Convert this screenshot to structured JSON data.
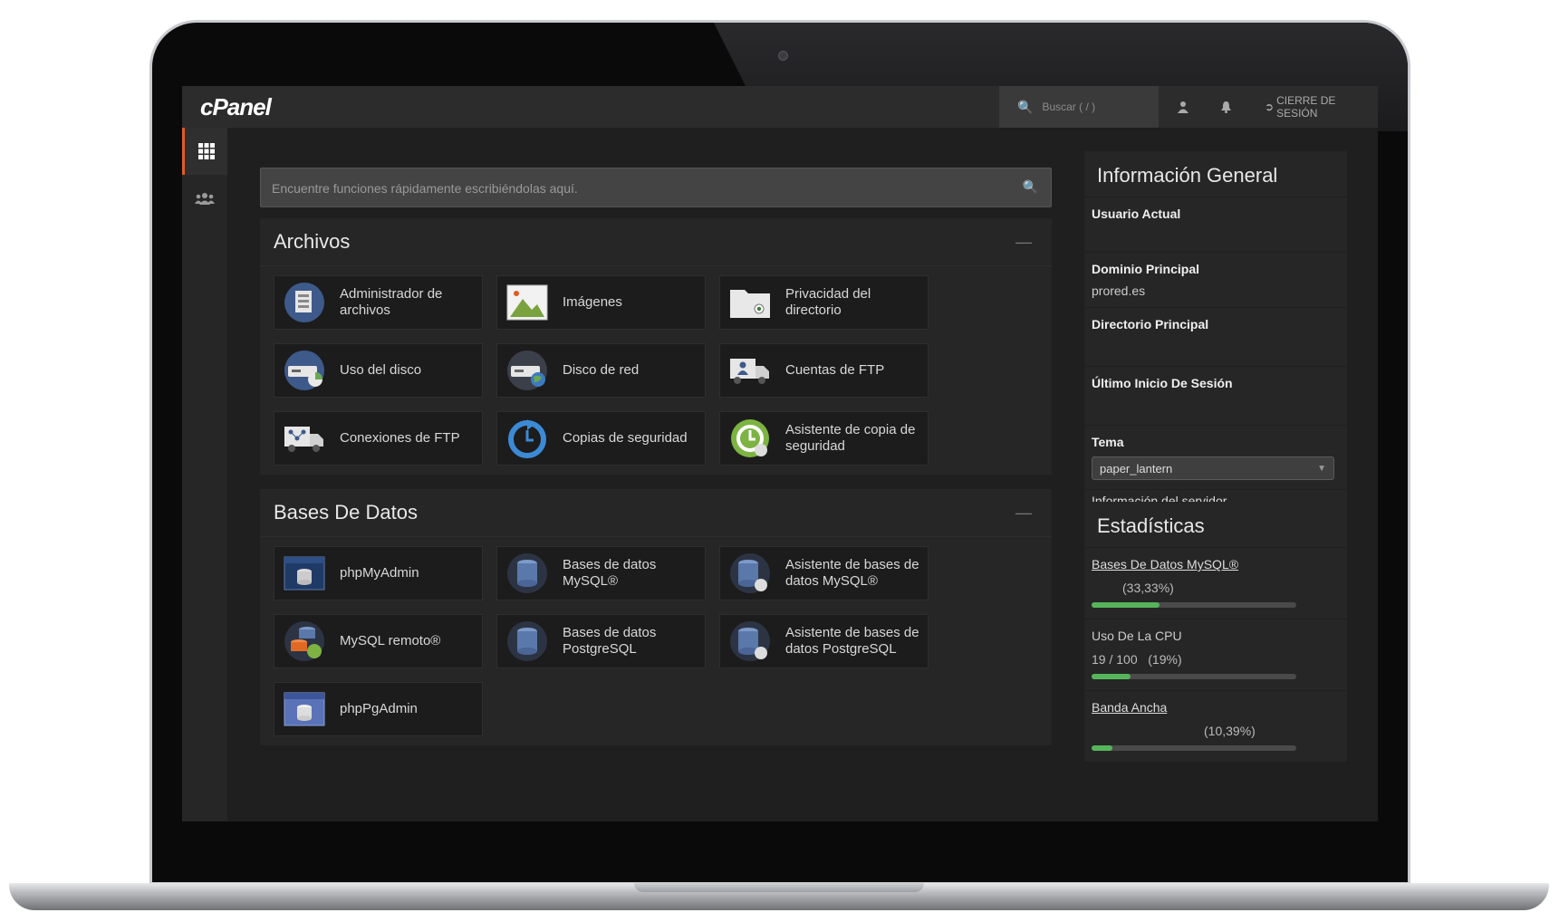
{
  "header": {
    "logo": "cPanel",
    "search_placeholder": "Buscar ( / )",
    "logout_label": "CIERRE DE SESIÓN"
  },
  "sidebar": {
    "items": [
      {
        "icon": "grid-icon"
      },
      {
        "icon": "users-icon"
      }
    ]
  },
  "find": {
    "placeholder": "Encuentre funciones rápidamente escribiéndolas aquí."
  },
  "sections": {
    "files": {
      "title": "Archivos",
      "items": [
        {
          "label": "Administrador de archivos"
        },
        {
          "label": "Imágenes"
        },
        {
          "label": "Privacidad del directorio"
        },
        {
          "label": "Uso del disco"
        },
        {
          "label": "Disco de red"
        },
        {
          "label": "Cuentas de FTP"
        },
        {
          "label": "Conexiones de FTP"
        },
        {
          "label": "Copias de seguridad"
        },
        {
          "label": "Asistente de copia de seguridad"
        }
      ]
    },
    "databases": {
      "title": "Bases De Datos",
      "items": [
        {
          "label": "phpMyAdmin"
        },
        {
          "label": "Bases de datos MySQL®"
        },
        {
          "label": "Asistente de bases de datos MySQL®"
        },
        {
          "label": "MySQL remoto®"
        },
        {
          "label": "Bases de datos PostgreSQL"
        },
        {
          "label": "Asistente de bases de datos PostgreSQL"
        },
        {
          "label": "phpPgAdmin"
        }
      ]
    }
  },
  "general_info": {
    "title": "Información General",
    "current_user_label": "Usuario Actual",
    "main_domain_label": "Dominio Principal",
    "main_domain_value": "prored.es",
    "home_dir_label": "Directorio Principal",
    "last_login_label": "Último Inicio De Sesión",
    "theme_label": "Tema",
    "theme_value": "paper_lantern",
    "server_info_link": "Información del servidor"
  },
  "statistics": {
    "title": "Estadísticas",
    "items": [
      {
        "label": "Bases De Datos MySQL®",
        "value": "(33,33%)",
        "fraction": 0.3333
      },
      {
        "label": "Uso De La CPU",
        "value": "19 / 100   (19%)",
        "fraction": 0.19
      },
      {
        "label": "Banda Ancha",
        "value": "(10,39%)",
        "fraction": 0.1039
      }
    ]
  },
  "colors": {
    "accent": "#e05b24",
    "progress": "#56b55a",
    "background": "#1f1f1f"
  }
}
